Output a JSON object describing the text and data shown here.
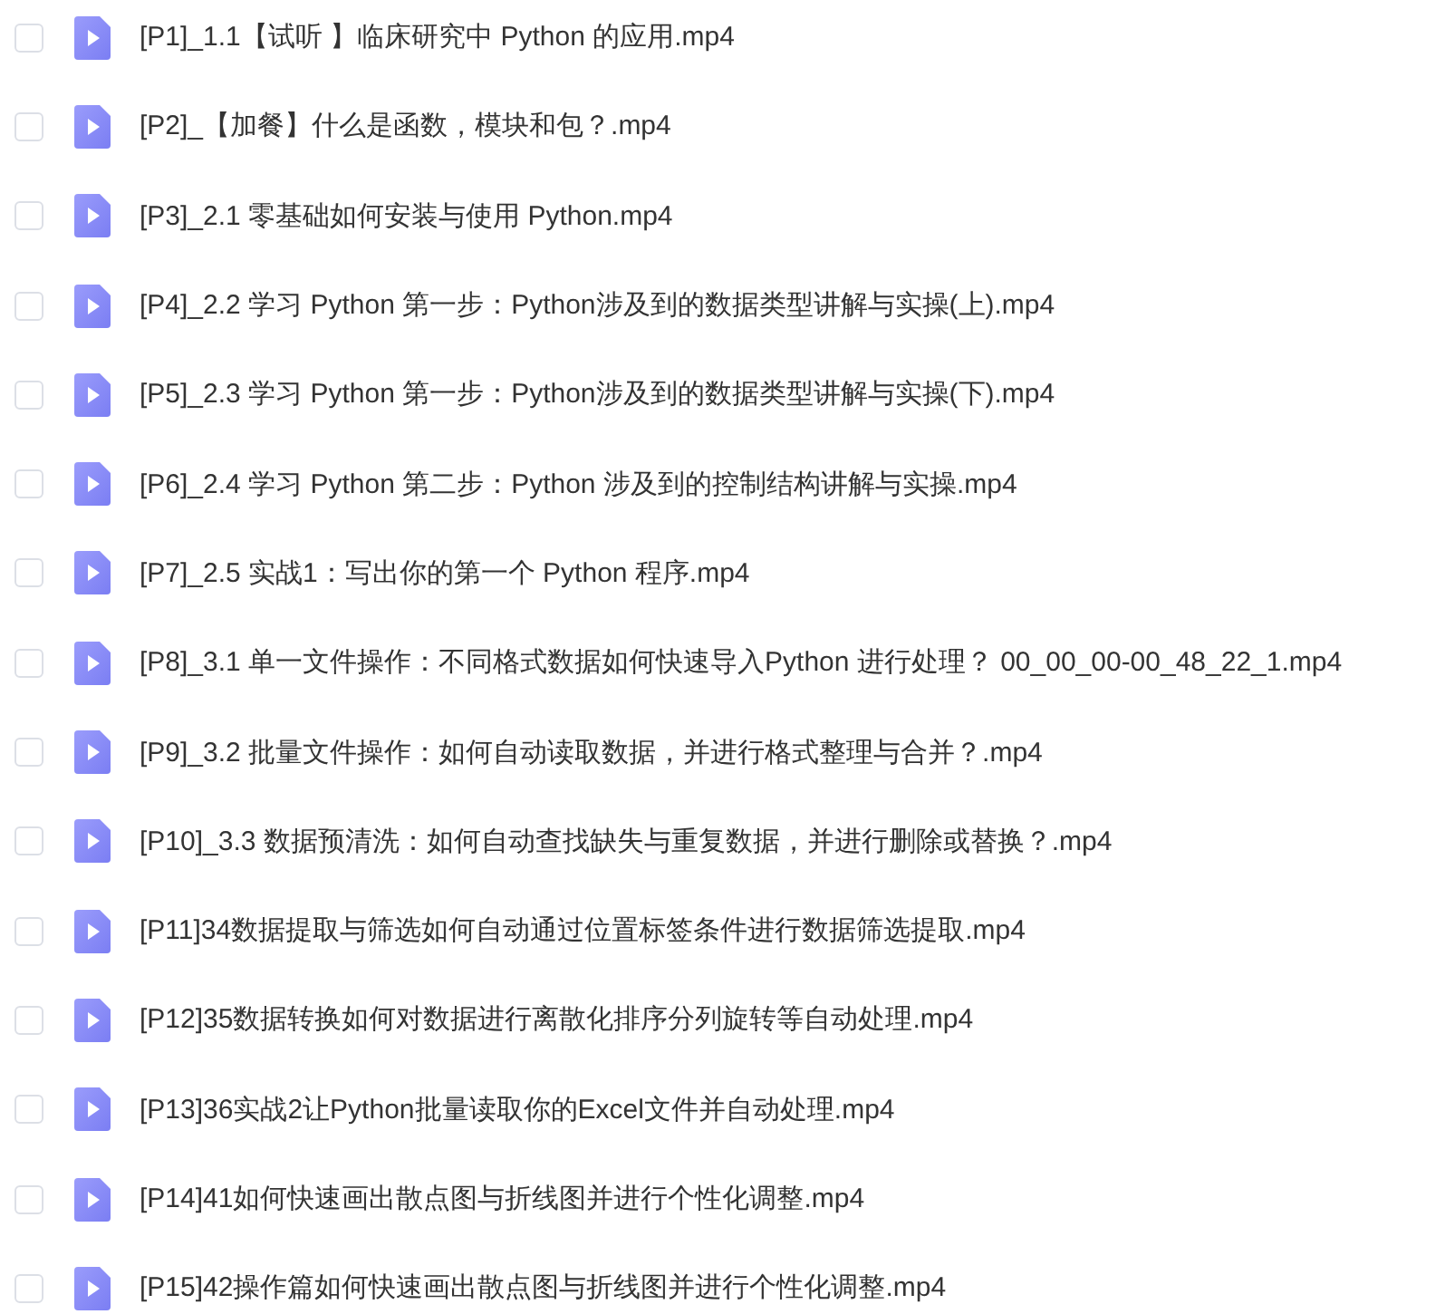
{
  "files": [
    {
      "name": "[P1]_1.1【试听 】临床研究中 Python 的应用.mp4",
      "checked": false
    },
    {
      "name": "[P2]_【加餐】什么是函数，模块和包？.mp4",
      "checked": false
    },
    {
      "name": "[P3]_2.1 零基础如何安装与使用 Python.mp4",
      "checked": false
    },
    {
      "name": "[P4]_2.2 学习 Python 第一步：Python涉及到的数据类型讲解与实操(上).mp4",
      "checked": false
    },
    {
      "name": "[P5]_2.3 学习 Python 第一步：Python涉及到的数据类型讲解与实操(下).mp4",
      "checked": false
    },
    {
      "name": "[P6]_2.4 学习 Python 第二步：Python 涉及到的控制结构讲解与实操.mp4",
      "checked": false
    },
    {
      "name": "[P7]_2.5 实战1：写出你的第一个 Python 程序.mp4",
      "checked": false
    },
    {
      "name": "[P8]_3.1 单一文件操作：不同格式数据如何快速导入Python 进行处理？ 00_00_00-00_48_22_1.mp4",
      "checked": false
    },
    {
      "name": "[P9]_3.2 批量文件操作：如何自动读取数据，并进行格式整理与合并？.mp4",
      "checked": false
    },
    {
      "name": "[P10]_3.3 数据预清洗：如何自动查找缺失与重复数据，并进行删除或替换？.mp4",
      "checked": false
    },
    {
      "name": "[P11]34数据提取与筛选如何自动通过位置标签条件进行数据筛选提取.mp4",
      "checked": false
    },
    {
      "name": "[P12]35数据转换如何对数据进行离散化排序分列旋转等自动处理.mp4",
      "checked": false
    },
    {
      "name": "[P13]36实战2让Python批量读取你的Excel文件并自动处理.mp4",
      "checked": false
    },
    {
      "name": "[P14]41如何快速画出散点图与折线图并进行个性化调整.mp4",
      "checked": false
    },
    {
      "name": "[P15]42操作篇如何快速画出散点图与折线图并进行个性化调整.mp4",
      "checked": false
    }
  ]
}
